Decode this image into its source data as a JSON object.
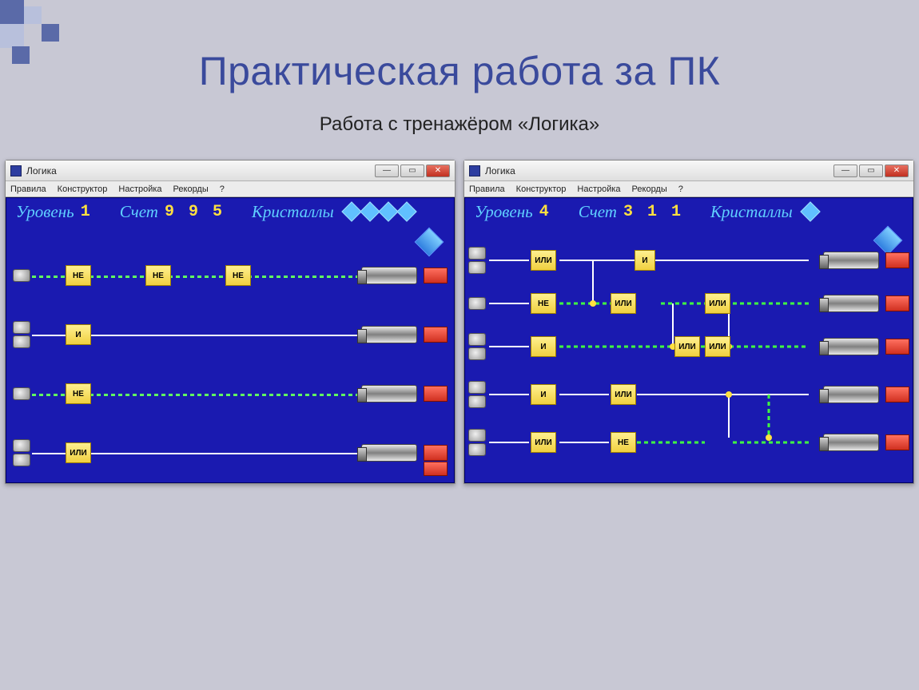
{
  "slide": {
    "title": "Практическая работа за ПК",
    "subtitle": "Работа с тренажёром «Логика»"
  },
  "app": {
    "window_title": "Логика",
    "menu": {
      "rules": "Правила",
      "constructor": "Конструктор",
      "settings": "Настройка",
      "records": "Рекорды",
      "help": "?"
    },
    "labels": {
      "level": "Уровень",
      "score": "Счет",
      "crystals": "Кристаллы"
    },
    "gates": {
      "not": "НЕ",
      "and": "И",
      "or": "ИЛИ"
    }
  },
  "left_window": {
    "level": "1",
    "score": "9 9 5",
    "crystals_count": 4,
    "rows": [
      {
        "inputs": 1,
        "gates": [
          "НЕ",
          "НЕ",
          "НЕ"
        ],
        "wire": "dashed"
      },
      {
        "inputs": 2,
        "gates": [
          "И"
        ],
        "wire": "solid"
      },
      {
        "inputs": 1,
        "gates": [
          "НЕ"
        ],
        "wire": "dashed"
      },
      {
        "inputs": 2,
        "gates": [
          "ИЛИ"
        ],
        "wire": "solid"
      }
    ]
  },
  "right_window": {
    "level": "4",
    "score": "3 1 1",
    "crystals_count": 1,
    "rows_count": 5,
    "gate_labels_used": [
      "ИЛИ",
      "НЕ",
      "И",
      "ИЛИ",
      "ИЛИ",
      "И",
      "ИЛИ",
      "ИЛИ",
      "НЕ"
    ]
  }
}
